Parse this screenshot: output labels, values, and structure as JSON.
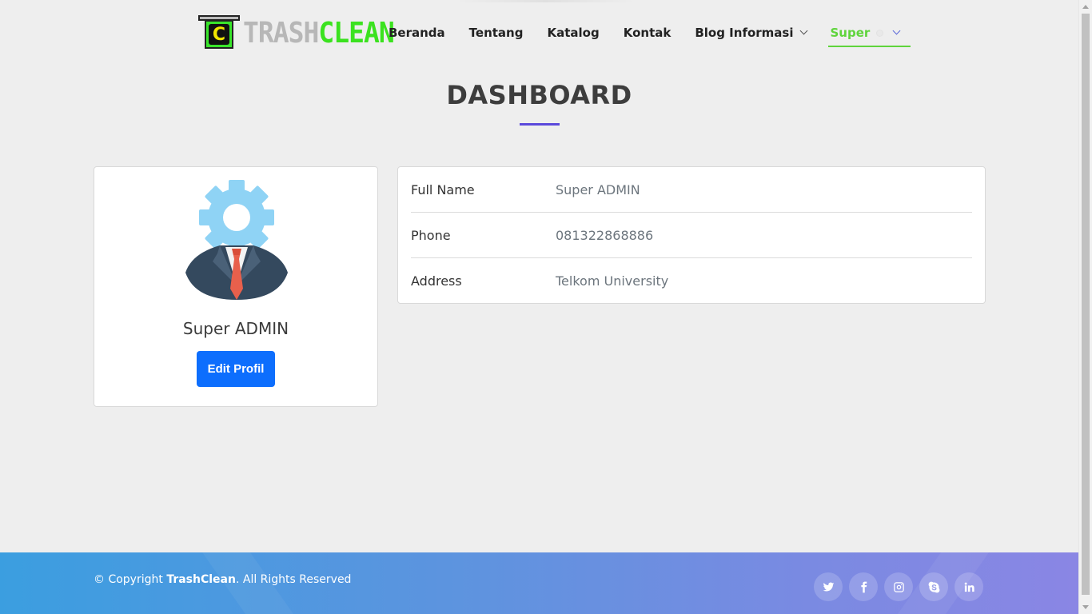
{
  "brand": {
    "mark_letter": "C",
    "word_part_1": "TRASH",
    "word_part_2": "CLEAN"
  },
  "nav": {
    "items": [
      {
        "label": "Beranda"
      },
      {
        "label": "Tentang"
      },
      {
        "label": "Katalog"
      },
      {
        "label": "Kontak"
      },
      {
        "label": "Blog Informasi",
        "has_dropdown": true
      },
      {
        "label": "Super",
        "has_dropdown": true,
        "active": true
      }
    ],
    "active_color": "#5fd43c"
  },
  "page": {
    "title": "DASHBOARD",
    "accent_color": "#5b49db"
  },
  "profile": {
    "name": "Super ADMIN",
    "edit_button_label": "Edit Profil",
    "avatar_icon": "admin-gear-avatar-icon"
  },
  "info": {
    "rows": [
      {
        "label": "Full Name",
        "value": "Super ADMIN"
      },
      {
        "label": "Phone",
        "value": "081322868886"
      },
      {
        "label": "Address",
        "value": "Telkom University"
      }
    ]
  },
  "footer": {
    "copyright_prefix": "© Copyright ",
    "copyright_brand": "TrashClean",
    "copyright_suffix": ". All Rights Reserved",
    "socials": [
      "twitter-icon",
      "facebook-icon",
      "instagram-icon",
      "skype-icon",
      "linkedin-icon"
    ]
  },
  "colors": {
    "primary_button": "#0d6efd",
    "background": "#eeeeee",
    "footer_gradient_start": "#3b9ee0",
    "footer_gradient_end": "#8a86e4"
  }
}
